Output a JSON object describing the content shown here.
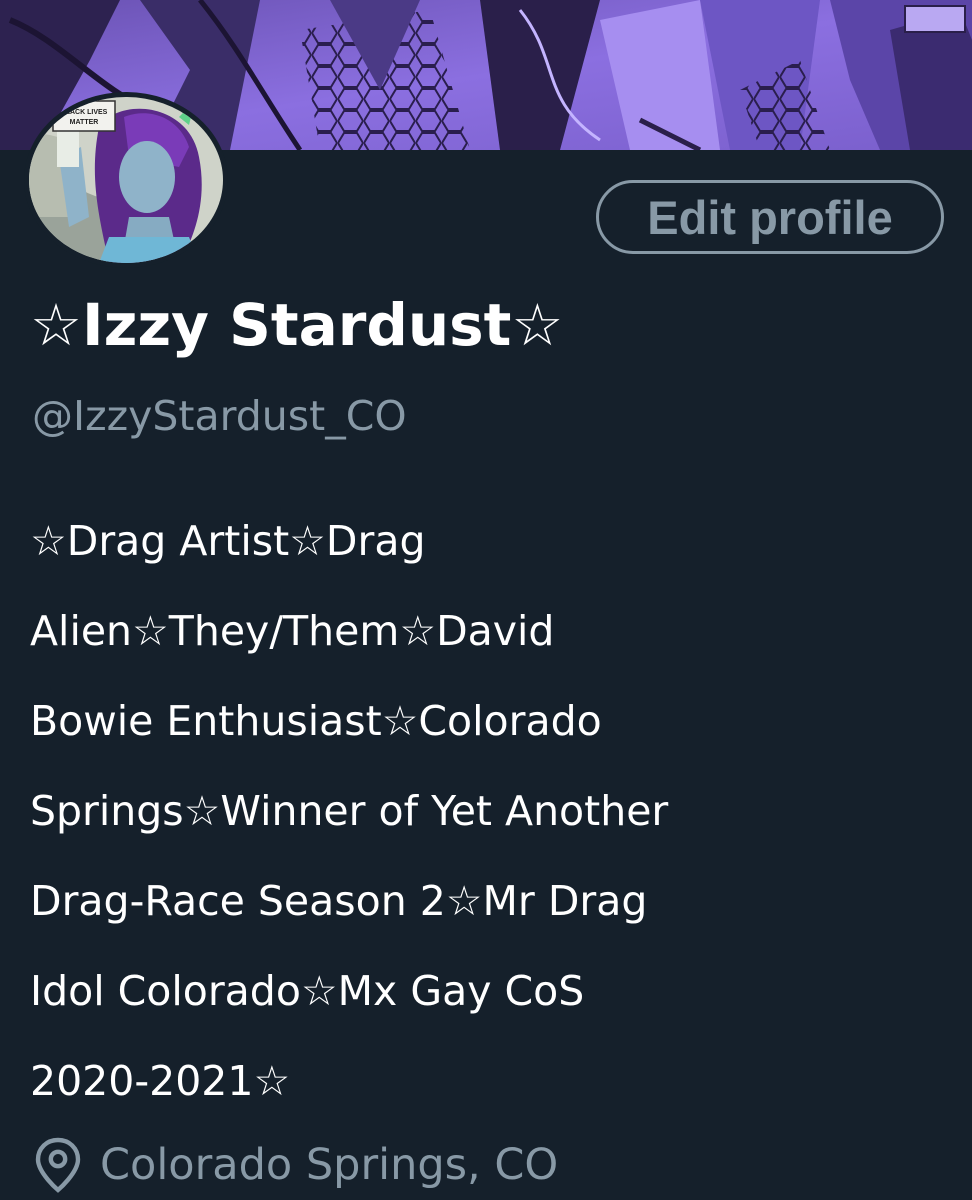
{
  "profile": {
    "display_name": "☆Izzy Stardust☆",
    "handle": "@IzzyStardust_CO",
    "edit_button_label": "Edit profile",
    "bio_lines": [
      "☆Drag Artist☆Drag",
      "Alien☆They/Them☆David",
      "Bowie Enthusiast☆Colorado",
      "Springs☆Winner of Yet Another",
      "Drag-Race Season 2☆Mr Drag",
      "Idol Colorado☆Mx Gay CoS",
      "2020-2021☆"
    ],
    "location": "Colorado Springs, CO",
    "location_icon": "location-pin-icon",
    "avatar_sign_text": "BLACK LIVES MATTER"
  },
  "colors": {
    "background": "#15202b",
    "primary_text": "#ffffff",
    "secondary_text": "#8899a6",
    "banner_purple": "#8a6bd6"
  }
}
